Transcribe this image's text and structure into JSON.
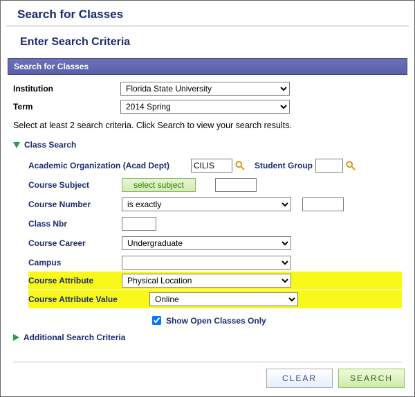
{
  "header": {
    "page_title": "Search for Classes",
    "subtitle": "Enter Search Criteria",
    "bar_title": "Search for Classes"
  },
  "basic": {
    "institution_label": "Institution",
    "institution_value": "Florida State University",
    "term_label": "Term",
    "term_value": "2014 Spring",
    "instruction": "Select at least 2 search criteria. Click Search to view your search results."
  },
  "sections": {
    "class_search": "Class Search",
    "additional": "Additional Search Criteria"
  },
  "form": {
    "acad_org_label": "Academic Organization (Acad Dept)",
    "acad_org_value": "CILIS",
    "student_group_label": "Student Group",
    "student_group_value": "",
    "course_subject_label": "Course Subject",
    "select_subject_btn": "select subject",
    "course_subject_value": "",
    "course_number_label": "Course Number",
    "course_number_op": "is exactly",
    "course_number_value": "",
    "class_nbr_label": "Class Nbr",
    "class_nbr_value": "",
    "course_career_label": "Course Career",
    "course_career_value": "Undergraduate",
    "campus_label": "Campus",
    "campus_value": "",
    "course_attribute_label": "Course Attribute",
    "course_attribute_value": "Physical Location",
    "course_attribute_value_label": "Course Attribute Value",
    "course_attribute_value_value": "Online",
    "show_open_label": "Show Open Classes Only"
  },
  "buttons": {
    "clear": "Clear",
    "search": "Search"
  }
}
